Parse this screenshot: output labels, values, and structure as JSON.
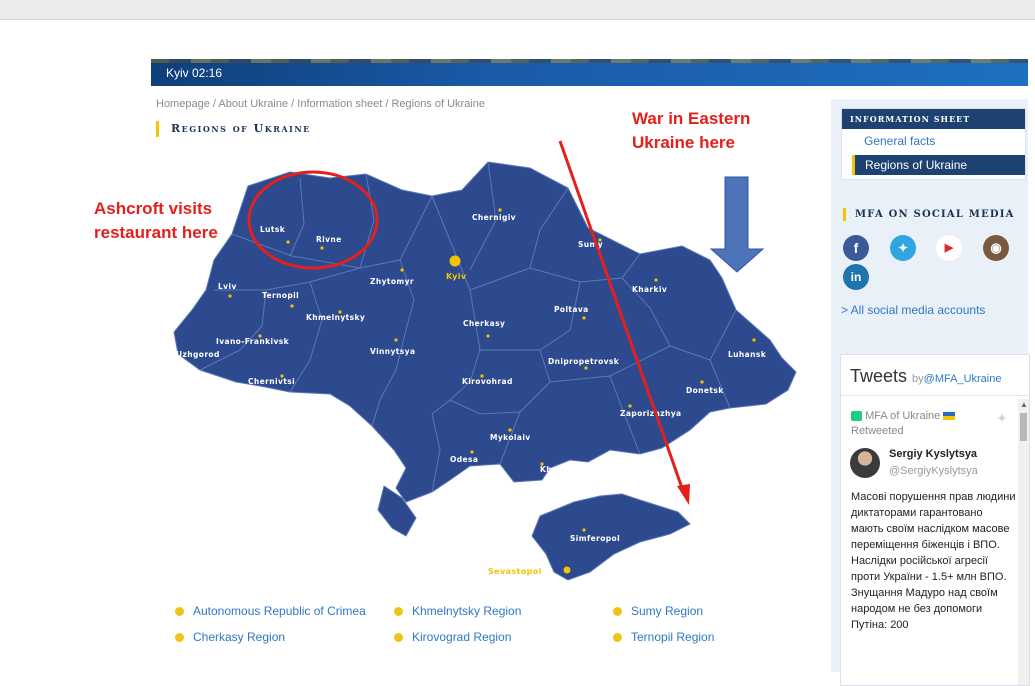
{
  "header": {
    "clock": "Kyiv 02:16"
  },
  "breadcrumb": [
    "Homepage",
    "About Ukraine",
    "Information sheet",
    "Regions of Ukraine"
  ],
  "page_title": "Regions of Ukraine",
  "map": {
    "capital": "Kyiv",
    "regions": [
      "Lutsk",
      "Rivne",
      "Chernigiv",
      "Sumy",
      "Zhytomyr",
      "Lviv",
      "Ternopil",
      "Khmelnytsky",
      "Kharkiv",
      "Poltava",
      "Cherkasy",
      "Ivano-Frankivsk",
      "Uzhgorod",
      "Vinnytsya",
      "Luhansk",
      "Chernivtsi",
      "Dnipropetrovsk",
      "Kirovohrad",
      "Donetsk",
      "Zaporizhzhya",
      "Mykolaiv",
      "Odesa",
      "Kherson",
      "Simferopol",
      "Sevastopol"
    ]
  },
  "annotations": {
    "war": [
      "War in Eastern",
      "Ukraine here"
    ],
    "ashcroft": [
      "Ashcroft visits",
      "restaurant here"
    ],
    "color": "#e3201b"
  },
  "regions_list": [
    [
      "Autonomous Republic of Crimea",
      "Cherkasy Region"
    ],
    [
      "Khmelnytsky Region",
      "Kirovograd Region"
    ],
    [
      "Sumy Region",
      "Ternopil Region"
    ]
  ],
  "sidebar": {
    "info_title": "Information sheet",
    "info_links": [
      "General facts",
      "Regions of Ukraine"
    ],
    "social_title": "MFA on social media",
    "social_icons": [
      "facebook-icon",
      "twitter-icon",
      "youtube-icon",
      "instagram-icon",
      "linkedin-icon"
    ],
    "all_social": "> All social media accounts"
  },
  "tweets": {
    "title": "Tweets",
    "by": "by",
    "handle": "@MFA_Ukraine",
    "retweeted_from": "MFA of Ukraine",
    "retweeted_label": "Retweeted",
    "author_name": "Sergiy Kyslytsya",
    "author_handle": "@SergiyKyslytsya",
    "text": "Масові порушення прав людини диктаторами гарантовано мають своїм наслідком масове переміщення біженців і ВПО. Наслідки російської агресії проти України - 1.5+ млн ВПО. Знущання Мадуро над своїм народом не без допомоги Путіна: 200"
  },
  "colors": {
    "map_fill": "#2d4a8e",
    "accent": "#f4c400",
    "link": "#2f78c4",
    "nav_dark": "#1d4170"
  }
}
